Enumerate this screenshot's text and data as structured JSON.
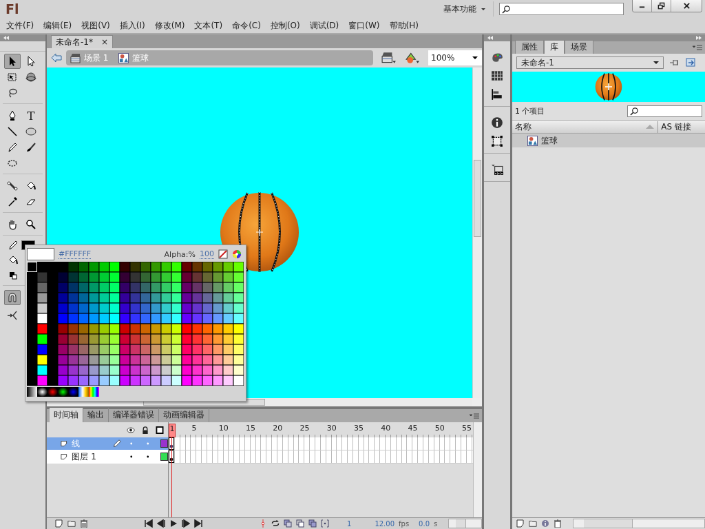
{
  "app": {
    "logo": "Fl",
    "workspace": "基本功能"
  },
  "menu": [
    "文件(F)",
    "编辑(E)",
    "视图(V)",
    "插入(I)",
    "修改(M)",
    "文本(T)",
    "命令(C)",
    "控制(O)",
    "调试(D)",
    "窗口(W)",
    "帮助(H)"
  ],
  "document_tab": {
    "title": "未命名-1*",
    "close": "×"
  },
  "edit_bar": {
    "breadcrumbs": [
      {
        "label": "场景 1",
        "kind": "scene"
      },
      {
        "label": "篮球",
        "kind": "symbol"
      }
    ],
    "zoom": "100%"
  },
  "tool_groups": [
    [
      {
        "kind": "select",
        "selected": true
      },
      {
        "kind": "subselect",
        "selected": false
      },
      {
        "kind": "transform",
        "selected": false
      },
      {
        "kind": "rotate3d",
        "selected": false
      },
      {
        "kind": "lasso",
        "selected": false
      }
    ],
    [
      {
        "kind": "pen",
        "selected": false
      },
      {
        "kind": "text",
        "glyph": "T",
        "selected": false
      },
      {
        "kind": "line",
        "selected": false
      },
      {
        "kind": "oval",
        "selected": false
      },
      {
        "kind": "pencil",
        "selected": false
      },
      {
        "kind": "brush",
        "selected": false
      },
      {
        "kind": "deco",
        "selected": false
      }
    ],
    [
      {
        "kind": "bone",
        "selected": false
      },
      {
        "kind": "bucket",
        "selected": false
      },
      {
        "kind": "eyedropper",
        "selected": false
      },
      {
        "kind": "eraser",
        "selected": false
      }
    ],
    [
      {
        "kind": "hand",
        "selected": false
      },
      {
        "kind": "zoom",
        "selected": false
      }
    ]
  ],
  "snap": {
    "on": true
  },
  "color_picker": {
    "hex": "#FFFFFF",
    "alpha_label": "Alpha:%",
    "alpha": "100"
  },
  "library": {
    "tabs": [
      {
        "label": "属性",
        "selected": false
      },
      {
        "label": "库",
        "selected": true
      },
      {
        "label": "场景",
        "selected": false
      }
    ],
    "document": "未命名-1",
    "count": "1 个项目",
    "columns": [
      "名称",
      "AS 链接"
    ],
    "items": [
      {
        "name": "篮球",
        "selected": true
      }
    ]
  },
  "timeline": {
    "tabs": [
      {
        "label": "时间轴",
        "selected": true
      },
      {
        "label": "输出",
        "selected": false
      },
      {
        "label": "编译器错误",
        "selected": false
      },
      {
        "label": "动画编辑器",
        "selected": false
      }
    ],
    "playhead": "1",
    "ruler": [
      "5",
      "10",
      "15",
      "20",
      "25",
      "30",
      "35",
      "40",
      "45",
      "50",
      "55"
    ],
    "layers": [
      {
        "name": "线",
        "selected": true,
        "editing": true,
        "color": "#9933cc"
      },
      {
        "name": "图层 1",
        "selected": false,
        "editing": false,
        "color": "#33dd55"
      }
    ],
    "current_frame": "1",
    "fps": "12.00",
    "fps_unit": "fps",
    "time": "0.0",
    "time_unit": "s"
  }
}
